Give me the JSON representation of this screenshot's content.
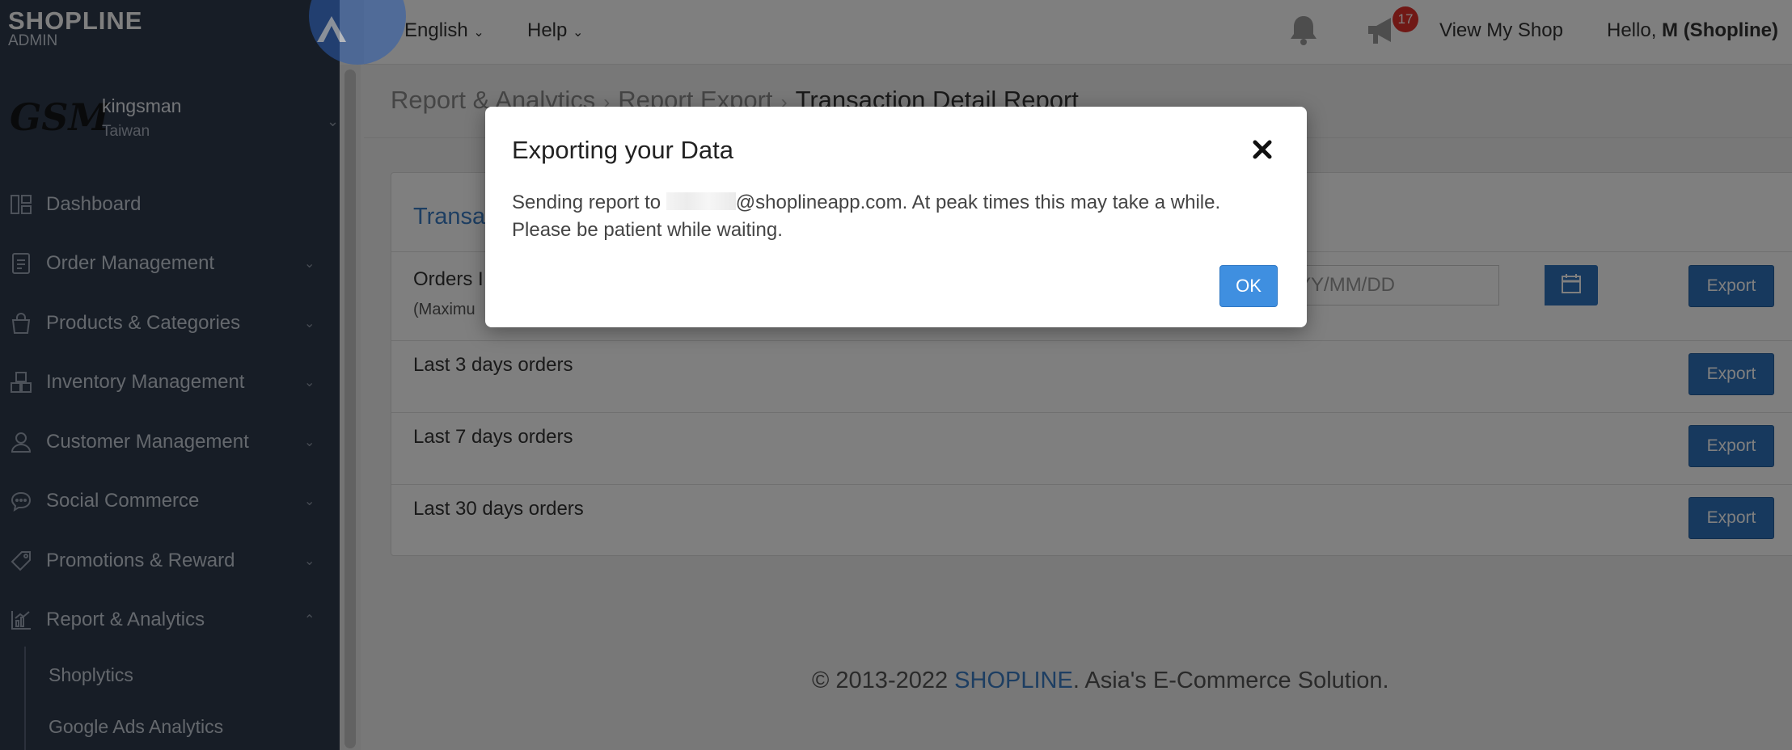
{
  "app": {
    "logo_brand": "SHOPLINE",
    "logo_sub": "ADMIN"
  },
  "shop": {
    "logo_text": "GSM",
    "name": "kingsman",
    "region": "Taiwan"
  },
  "sidebar": {
    "items": [
      {
        "label": "Dashboard",
        "icon": "dashboard-icon",
        "expandable": false
      },
      {
        "label": "Order Management",
        "icon": "order-icon",
        "expandable": true
      },
      {
        "label": "Products & Categories",
        "icon": "bag-icon",
        "expandable": true
      },
      {
        "label": "Inventory Management",
        "icon": "boxes-icon",
        "expandable": true
      },
      {
        "label": "Customer Management",
        "icon": "user-icon",
        "expandable": true
      },
      {
        "label": "Social Commerce",
        "icon": "chat-icon",
        "expandable": true
      },
      {
        "label": "Promotions & Reward",
        "icon": "tag-icon",
        "expandable": true
      },
      {
        "label": "Report & Analytics",
        "icon": "chart-icon",
        "expandable": true,
        "expanded": true
      }
    ],
    "subitems": [
      {
        "label": "Shoplytics"
      },
      {
        "label": "Google Ads Analytics"
      }
    ]
  },
  "header": {
    "language": "English",
    "help": "Help",
    "notification_count": "17",
    "view_shop": "View My Shop",
    "greeting_prefix": "Hello, ",
    "greeting_name": "M (Shopline)"
  },
  "breadcrumb": {
    "items": [
      "Report & Analytics",
      "Report Export",
      "Transaction Detail Report"
    ]
  },
  "panel": {
    "title": "Transa",
    "rows": [
      {
        "label": "Orders I",
        "sublabel": "(Maximu",
        "date_placeholder": "YYYY/MM/DD",
        "export": "Export"
      },
      {
        "label": "Last 3 days orders",
        "export": "Export"
      },
      {
        "label": "Last 7 days orders",
        "export": "Export"
      },
      {
        "label": "Last 30 days orders",
        "export": "Export"
      }
    ]
  },
  "footer": {
    "prefix": "© 2013-2022 ",
    "brand": "SHOPLINE",
    "suffix": ". Asia's E-Commerce Solution."
  },
  "modal": {
    "title": "Exporting your Data",
    "body_prefix": "Sending report to ",
    "body_email_domain": "@shoplineapp.com. At peak times this may take a while.",
    "body_line2": "Please be patient while waiting.",
    "ok": "OK"
  },
  "colors": {
    "sidebar_bg": "#2f3a4c",
    "accent_blue": "#2f73bd",
    "link_blue": "#3b7cc4",
    "badge_red": "#e0302b"
  }
}
